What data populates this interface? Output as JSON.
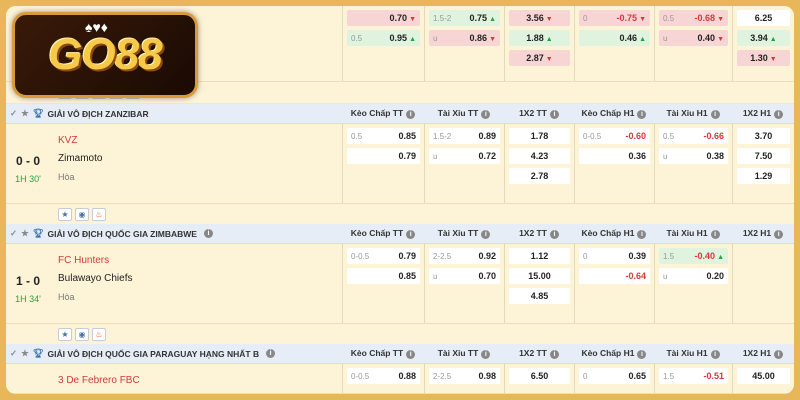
{
  "logo": {
    "text": "GO88",
    "cards": "♠♥♦"
  },
  "headers": [
    "Kèo Chấp TT",
    "Tài Xỉu TT",
    "1X2 TT",
    "Kèo Chấp H1",
    "Tài Xỉu H1",
    "1X2 H1"
  ],
  "top_match": {
    "hcap": [
      {
        "hc": "",
        "od": "0.70",
        "dir": "down"
      },
      {
        "hc": "0.5",
        "od": "0.95",
        "dir": "up"
      }
    ],
    "ou": [
      {
        "hc": "1.5-2",
        "od": "0.75",
        "dir": "up"
      },
      {
        "hc": "u",
        "od": "0.86",
        "dir": "down"
      }
    ],
    "x12": [
      {
        "od": "3.56",
        "dir": "down"
      },
      {
        "od": "1.88",
        "dir": "up"
      },
      {
        "od": "2.87",
        "dir": "down"
      }
    ],
    "hcap_h1": [
      {
        "hc": "0",
        "od": "-0.75",
        "dir": "down",
        "neg": true
      },
      {
        "hc": "",
        "od": "0.46",
        "dir": "up"
      }
    ],
    "ou_h1": [
      {
        "hc": "0.5",
        "od": "-0.68",
        "dir": "down",
        "neg": true
      },
      {
        "hc": "u",
        "od": "0.40",
        "dir": "down"
      }
    ],
    "x12_h1": [
      {
        "od": "6.25",
        "dir": ""
      },
      {
        "od": "3.94",
        "dir": "up"
      },
      {
        "od": "1.30",
        "dir": "down"
      }
    ]
  },
  "leagues": [
    {
      "name": "GIẢI VÔ ĐỊCH ZANZIBAR",
      "score": "0 - 0",
      "minute": "1H 30'",
      "home": "KVZ",
      "away": "Zimamoto",
      "draw": "Hòa",
      "hcap": [
        {
          "hc": "0.5",
          "od": "0.85",
          "dir": ""
        },
        {
          "hc": "",
          "od": "0.79",
          "dir": ""
        }
      ],
      "ou": [
        {
          "hc": "1.5-2",
          "od": "0.89",
          "dir": ""
        },
        {
          "hc": "u",
          "od": "0.72",
          "dir": ""
        }
      ],
      "x12": [
        {
          "od": "1.78",
          "dir": ""
        },
        {
          "od": "4.23",
          "dir": ""
        },
        {
          "od": "2.78",
          "dir": ""
        }
      ],
      "hcap_h1": [
        {
          "hc": "0-0.5",
          "od": "-0.60",
          "dir": "",
          "neg": true
        },
        {
          "hc": "",
          "od": "0.36",
          "dir": ""
        }
      ],
      "ou_h1": [
        {
          "hc": "0.5",
          "od": "-0.66",
          "dir": "",
          "neg": true
        },
        {
          "hc": "u",
          "od": "0.38",
          "dir": ""
        }
      ],
      "x12_h1": [
        {
          "od": "3.70",
          "dir": ""
        },
        {
          "od": "7.50",
          "dir": ""
        },
        {
          "od": "1.29",
          "dir": ""
        }
      ]
    },
    {
      "name": "GIẢI VÔ ĐỊCH QUỐC GIA ZIMBABWE",
      "score": "1 - 0",
      "minute": "1H 34'",
      "home": "FC Hunters",
      "away": "Bulawayo Chiefs",
      "draw": "Hòa",
      "hcap": [
        {
          "hc": "0-0.5",
          "od": "0.79",
          "dir": ""
        },
        {
          "hc": "",
          "od": "0.85",
          "dir": ""
        }
      ],
      "ou": [
        {
          "hc": "2-2.5",
          "od": "0.92",
          "dir": ""
        },
        {
          "hc": "u",
          "od": "0.70",
          "dir": ""
        }
      ],
      "x12": [
        {
          "od": "1.12",
          "dir": ""
        },
        {
          "od": "15.00",
          "dir": ""
        },
        {
          "od": "4.85",
          "dir": ""
        }
      ],
      "hcap_h1": [
        {
          "hc": "0",
          "od": "0.39",
          "dir": ""
        },
        {
          "hc": "",
          "od": "-0.64",
          "dir": "",
          "neg": true
        }
      ],
      "ou_h1": [
        {
          "hc": "1.5",
          "od": "-0.40",
          "dir": "up",
          "neg": true
        },
        {
          "hc": "u",
          "od": "0.20",
          "dir": ""
        }
      ],
      "x12_h1": [
        {
          "od": "",
          "dir": ""
        },
        {
          "od": "",
          "dir": ""
        },
        {
          "od": "",
          "dir": ""
        }
      ]
    },
    {
      "name": "GIẢI VÔ ĐỊCH QUỐC GIA PARAGUAY HẠNG NHẤT B",
      "home": "3 De Febrero FBC",
      "hcap": [
        {
          "hc": "0-0.5",
          "od": "0.88",
          "dir": ""
        }
      ],
      "ou": [
        {
          "hc": "2-2.5",
          "od": "0.98",
          "dir": ""
        }
      ],
      "x12": [
        {
          "od": "6.50",
          "dir": ""
        }
      ],
      "hcap_h1": [
        {
          "hc": "0",
          "od": "0.65",
          "dir": ""
        }
      ],
      "ou_h1": [
        {
          "hc": "1.5",
          "od": "-0.51",
          "dir": "",
          "neg": true
        }
      ],
      "x12_h1": [
        {
          "od": "45.00",
          "dir": ""
        }
      ]
    }
  ]
}
